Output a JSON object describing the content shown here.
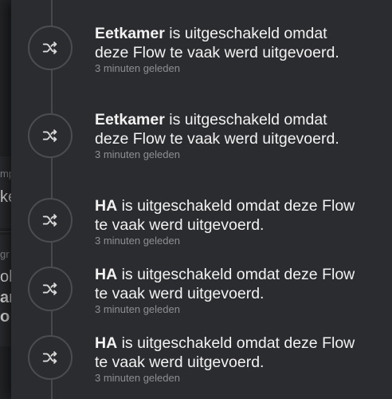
{
  "background_app": {
    "fragments": [
      "mp",
      "ke",
      "gr",
      "oh",
      "ar",
      "o"
    ]
  },
  "notifications": {
    "top_fragment": "",
    "items": [
      {
        "icon": "shuffle-icon",
        "subject": "Eetkamer",
        "message": " is uitgeschakeld omdat deze Flow te vaak werd uitgevoerd.",
        "time": "3 minuten geleden"
      },
      {
        "icon": "shuffle-icon",
        "subject": "Eetkamer",
        "message": " is uitgeschakeld omdat deze Flow te vaak werd uitgevoerd.",
        "time": "3 minuten geleden"
      },
      {
        "icon": "shuffle-icon",
        "subject": "HA",
        "message": " is uitgeschakeld omdat deze Flow te vaak werd uitgevoerd.",
        "time": "3 minuten geleden"
      },
      {
        "icon": "shuffle-icon",
        "subject": "HA",
        "message": " is uitgeschakeld omdat deze Flow te vaak werd uitgevoerd.",
        "time": "3 minuten geleden"
      },
      {
        "icon": "shuffle-icon",
        "subject": "HA",
        "message": " is uitgeschakeld omdat deze Flow te vaak werd uitgevoerd.",
        "time": "3 minuten geleden"
      }
    ]
  },
  "colors": {
    "panel_bg": "#2b2c2f",
    "text_primary": "#f2f2f2",
    "text_secondary": "#8e8f93",
    "icon_stroke": "#d9d9d9",
    "timeline": "#47484b"
  }
}
